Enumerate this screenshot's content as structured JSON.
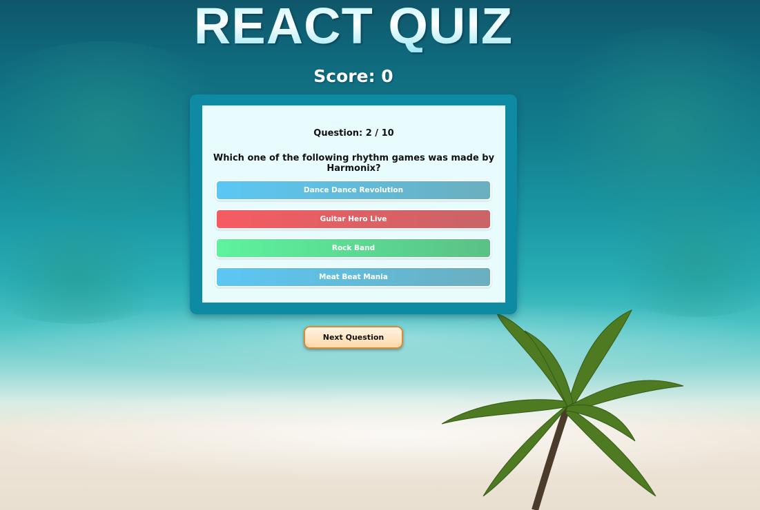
{
  "title": "REACT QUIZ",
  "score_text": "Score: 0",
  "question": {
    "number_text": "Question: 2 / 10",
    "text": "Which one of the following rhythm games was made by Harmonix?"
  },
  "answers": [
    {
      "label": "Dance Dance Revolution",
      "state": "neutral",
      "color": "#5bc7f4"
    },
    {
      "label": "Guitar Hero Live",
      "state": "incorrect",
      "color": "#f55c62"
    },
    {
      "label": "Rock Band",
      "state": "correct",
      "color": "#5cf39e"
    },
    {
      "label": "Meat Beat Mania",
      "state": "neutral",
      "color": "#5bc7f4"
    }
  ],
  "next_button_label": "Next Question",
  "colors": {
    "card_border": "#0e8ba3",
    "card_background": "#e9fcfd",
    "next_button_border": "#d98a3a"
  }
}
